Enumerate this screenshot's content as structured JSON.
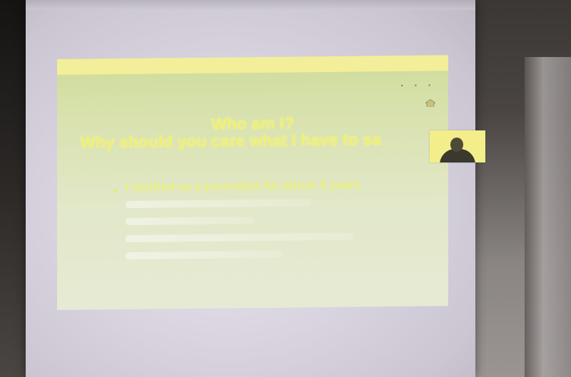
{
  "slide": {
    "title": "Who am I?",
    "subtitle": "Why should you care what I have to sa",
    "bullet_text": "I worked as a journalist for about 3 years"
  },
  "icons": {
    "home": "home-icon",
    "webcam": "presenter-webcam"
  },
  "colors": {
    "slide_background": "#d9e2b0",
    "header_bar": "#f4ee9a",
    "title_text": "#eef077",
    "screen": "#ddd8e4"
  }
}
